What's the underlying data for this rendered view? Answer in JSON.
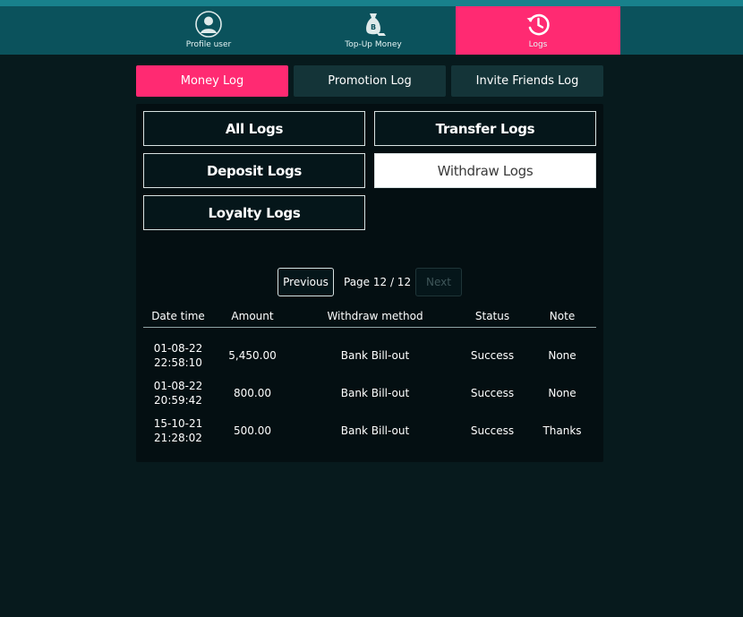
{
  "topnav": {
    "items": [
      {
        "label": "Profile user",
        "icon": "user-icon",
        "active": false
      },
      {
        "label": "Top-Up Money",
        "icon": "money-bag-icon",
        "active": false
      },
      {
        "label": "Logs",
        "icon": "history-icon",
        "active": true
      }
    ],
    "colors": {
      "bar": "#0b525c",
      "active": "#ff2a72",
      "strip": "#18818c"
    }
  },
  "tabs": [
    {
      "label": "Money Log",
      "active": true
    },
    {
      "label": "Promotion Log",
      "active": false
    },
    {
      "label": "Invite Friends Log",
      "active": false
    }
  ],
  "filters": {
    "all": "All Logs",
    "transfer": "Transfer Logs",
    "deposit": "Deposit Logs",
    "withdraw": "Withdraw Logs",
    "loyalty": "Loyalty Logs",
    "selected": "withdraw"
  },
  "pagination": {
    "previous": "Previous",
    "info": "Page 12 / 12",
    "next": "Next",
    "next_disabled": true
  },
  "table": {
    "headers": [
      "Date time",
      "Amount",
      "Withdraw method",
      "Status",
      "Note"
    ],
    "rows": [
      {
        "date": "01-08-22",
        "time": "22:58:10",
        "amount": "5,450.00",
        "method": "Bank Bill-out",
        "status": "Success",
        "note": "None"
      },
      {
        "date": "01-08-22",
        "time": "20:59:42",
        "amount": "800.00",
        "method": "Bank Bill-out",
        "status": "Success",
        "note": "None"
      },
      {
        "date": "15-10-21",
        "time": "21:28:02",
        "amount": "500.00",
        "method": "Bank Bill-out",
        "status": "Success",
        "note": "Thanks"
      }
    ]
  }
}
